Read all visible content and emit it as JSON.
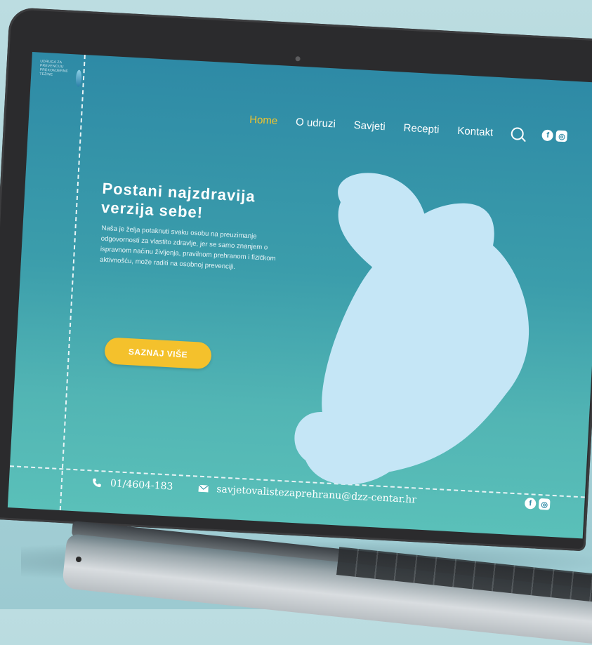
{
  "logo": {
    "lines": [
      "UDRUGA ZA",
      "PREVENCIJU",
      "PREKOMJERNE",
      "TEŽINE"
    ]
  },
  "nav": {
    "items": [
      {
        "label": "Home",
        "active": true
      },
      {
        "label": "O udruzi",
        "active": false
      },
      {
        "label": "Savjeti",
        "active": false
      },
      {
        "label": "Recepti",
        "active": false
      },
      {
        "label": "Kontakt",
        "active": false
      }
    ],
    "facebook_icon": "f",
    "instagram_icon": "◎"
  },
  "hero": {
    "title": "Postani najzdravija verzija sebe!",
    "text": "Naša je želja potaknuti svaku osobu na preuzimanje odgovornosti za vlastito zdravlje, jer se samo znanjem o ispravnom načinu življenja, pravilnom prehranom i fizičkom aktivnošću, može raditi na osobnoj prevenciji.",
    "cta_label": "SAZNAJ VIŠE"
  },
  "footer": {
    "phone": "01/4604-183",
    "email": "savjetovalistezaprehranu@dzz-centar.hr"
  },
  "colors": {
    "accent": "#f4c12c",
    "screen_top": "#2e8aa6",
    "screen_bottom": "#5ac0b9",
    "blob": "#c5e6f6"
  }
}
